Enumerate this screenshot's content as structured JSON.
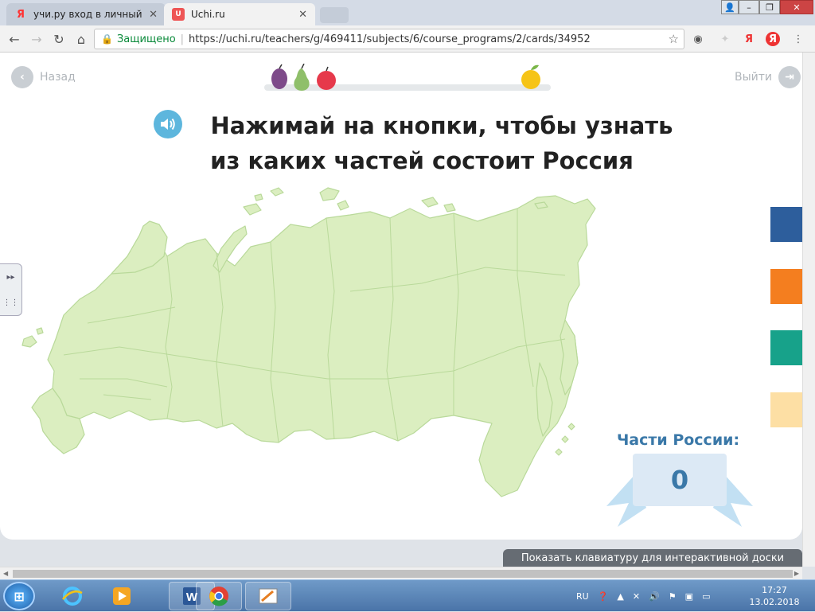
{
  "browser": {
    "tabs": [
      {
        "label": "учи.ру вход в личный ка",
        "favicon": "yandex-icon"
      },
      {
        "label": "Uchi.ru",
        "favicon": "uchi-icon"
      }
    ],
    "secure_label": "Защищено",
    "url": "https://uchi.ru/teachers/g/469411/subjects/6/course_programs/2/cards/34952"
  },
  "page": {
    "back_label": "Назад",
    "exit_label": "Выйти",
    "title_line1": "Нажимай на кнопки, чтобы узнать",
    "title_line2": "из каких частей состоит Россия",
    "counter_label": "Части России:",
    "counter_value": "0",
    "keyboard_button": "Показать клавиатуру для интерактивной доски",
    "side_tabs": [
      {
        "color": "#2d5e9c"
      },
      {
        "color": "#f47e1f"
      },
      {
        "color": "#17a28a"
      },
      {
        "color": "#fddfa4"
      }
    ],
    "progress_fruits": [
      "plum",
      "pear",
      "apple",
      "yellow-apple"
    ],
    "map_fill": "#dbeec0",
    "map_stroke": "#b9d99a"
  },
  "taskbar": {
    "language": "RU",
    "time": "17:27",
    "date": "13.02.2018"
  }
}
